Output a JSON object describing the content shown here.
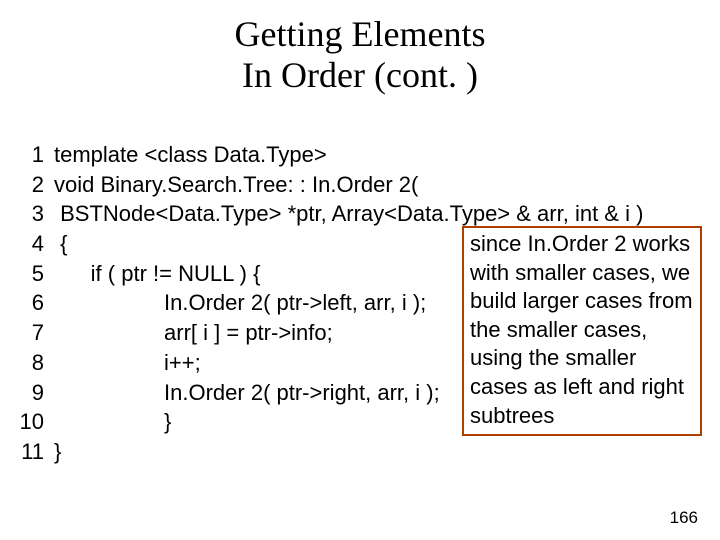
{
  "title": {
    "line1": "Getting Elements",
    "line2": "In Order (cont. )"
  },
  "code": {
    "l1": "template <class Data.Type>",
    "l2": "void Binary.Search.Tree: : In.Order 2(",
    "l3": " BSTNode<Data.Type> *ptr, Array<Data.Type> & arr, int & i )",
    "l4": " {",
    "l5": "      if ( ptr != NULL ) {",
    "l6": "                  In.Order 2( ptr->left, arr, i );",
    "l7": "                  arr[ i ] = ptr->info;",
    "l8": "                  i++;",
    "l9": "                  In.Order 2( ptr->right, arr, i );",
    "l10": "                  }",
    "l11": "}"
  },
  "note": "since In.Order 2 works with smaller cases, we build larger cases from the smaller cases, using the smaller cases as left and right subtrees",
  "page": "166"
}
